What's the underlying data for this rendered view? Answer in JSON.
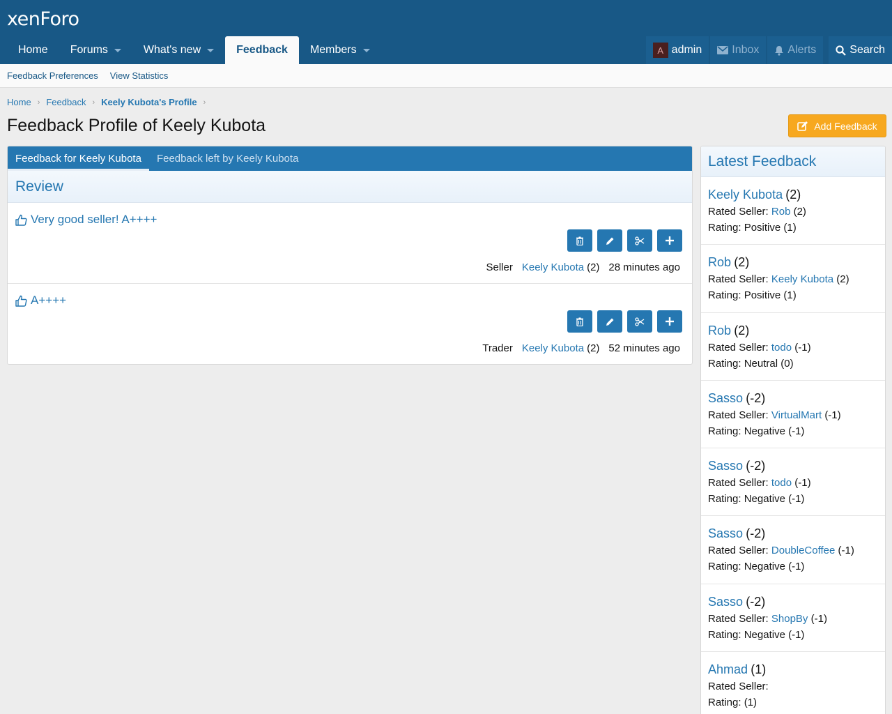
{
  "header": {
    "logo_text": "xenForo",
    "nav": [
      {
        "label": "Home"
      },
      {
        "label": "Forums"
      },
      {
        "label": "What's new"
      },
      {
        "label": "Feedback"
      },
      {
        "label": "Members"
      }
    ],
    "user": {
      "avatar_letter": "A",
      "name": "admin"
    },
    "inbox_label": "Inbox",
    "alerts_label": "Alerts",
    "search_label": "Search"
  },
  "subnav": [
    "Feedback Preferences",
    "View Statistics"
  ],
  "breadcrumb": [
    "Home",
    "Feedback",
    "Keely Kubota's Profile"
  ],
  "page_title": "Feedback Profile of Keely Kubota",
  "add_feedback_label": "Add Feedback",
  "tabs": [
    "Feedback for Keely Kubota",
    "Feedback left by Keely Kubota"
  ],
  "review_heading": "Review",
  "feedback": [
    {
      "text": "Very good seller! A++++",
      "role": "Seller",
      "user": "Keely Kubota",
      "count": "(2)",
      "time": "28 minutes ago"
    },
    {
      "text": "A++++",
      "role": "Trader",
      "user": "Keely Kubota",
      "count": "(2)",
      "time": "52 minutes ago"
    }
  ],
  "sidebar": {
    "title": "Latest Feedback",
    "rated_label": "Rated Seller:",
    "rating_label": "Rating:",
    "items": [
      {
        "name": "Keely Kubota",
        "score": "(2)",
        "seller": "Rob",
        "seller_score": "(2)",
        "rating": "Positive (1)"
      },
      {
        "name": "Rob",
        "score": "(2)",
        "seller": "Keely Kubota",
        "seller_score": "(2)",
        "rating": "Positive (1)"
      },
      {
        "name": "Rob",
        "score": "(2)",
        "seller": "todo",
        "seller_score": "(-1)",
        "rating": "Neutral (0)"
      },
      {
        "name": "Sasso",
        "score": "(-2)",
        "seller": "VirtualMart",
        "seller_score": "(-1)",
        "rating": "Negative (-1)"
      },
      {
        "name": "Sasso",
        "score": "(-2)",
        "seller": "todo",
        "seller_score": "(-1)",
        "rating": "Negative (-1)"
      },
      {
        "name": "Sasso",
        "score": "(-2)",
        "seller": "DoubleCoffee",
        "seller_score": "(-1)",
        "rating": "Negative (-1)"
      },
      {
        "name": "Sasso",
        "score": "(-2)",
        "seller": "ShopBy",
        "seller_score": "(-1)",
        "rating": "Negative (-1)"
      },
      {
        "name": "Ahmad",
        "score": "(1)",
        "seller": "",
        "seller_score": "",
        "rating": "(1)"
      }
    ]
  },
  "colors": {
    "header_bg": "#185886",
    "accent": "#2577b1",
    "add_button": "#f7a81f"
  }
}
